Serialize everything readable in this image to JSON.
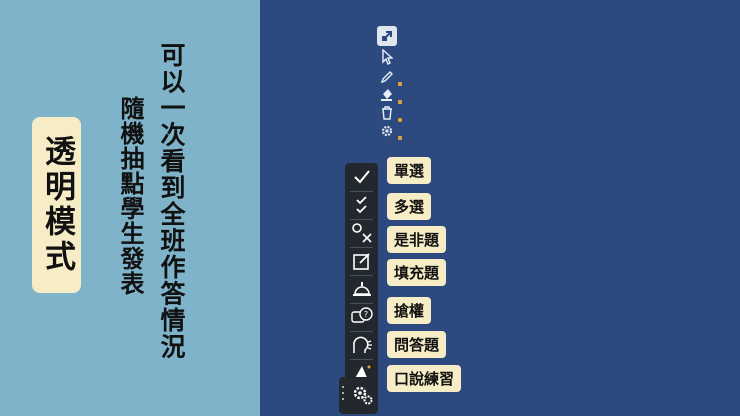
{
  "left": {
    "badge_text": "透明模式",
    "heading_line1": "可以一次看到全班作答情況",
    "heading_line2": "隨機抽點學生發表"
  },
  "mini_toolbar": {
    "icons": [
      "collapse-icon",
      "pointer-icon",
      "pen-icon",
      "fill-icon",
      "trash-icon",
      "settings-icon"
    ]
  },
  "toolbar": {
    "buttons": [
      {
        "icon": "single-check-icon",
        "label": "單選"
      },
      {
        "icon": "double-check-icon",
        "label": "多選"
      },
      {
        "icon": "true-false-icon",
        "label": "是非題"
      },
      {
        "icon": "fill-blank-icon",
        "label": "填充題"
      },
      {
        "icon": "buzzer-icon",
        "label": "搶權"
      },
      {
        "icon": "question-answer-icon",
        "label": "問答題"
      },
      {
        "icon": "speaking-icon",
        "label": "口說練習"
      }
    ],
    "extra_icons": [
      "wizard-hat-icon",
      "gears-icon"
    ]
  },
  "colors": {
    "left_bg": "#7fb3c9",
    "right_bg": "#2c4a7f",
    "label_bg": "#f6ecc6",
    "toolbar_bg": "#23272e"
  }
}
